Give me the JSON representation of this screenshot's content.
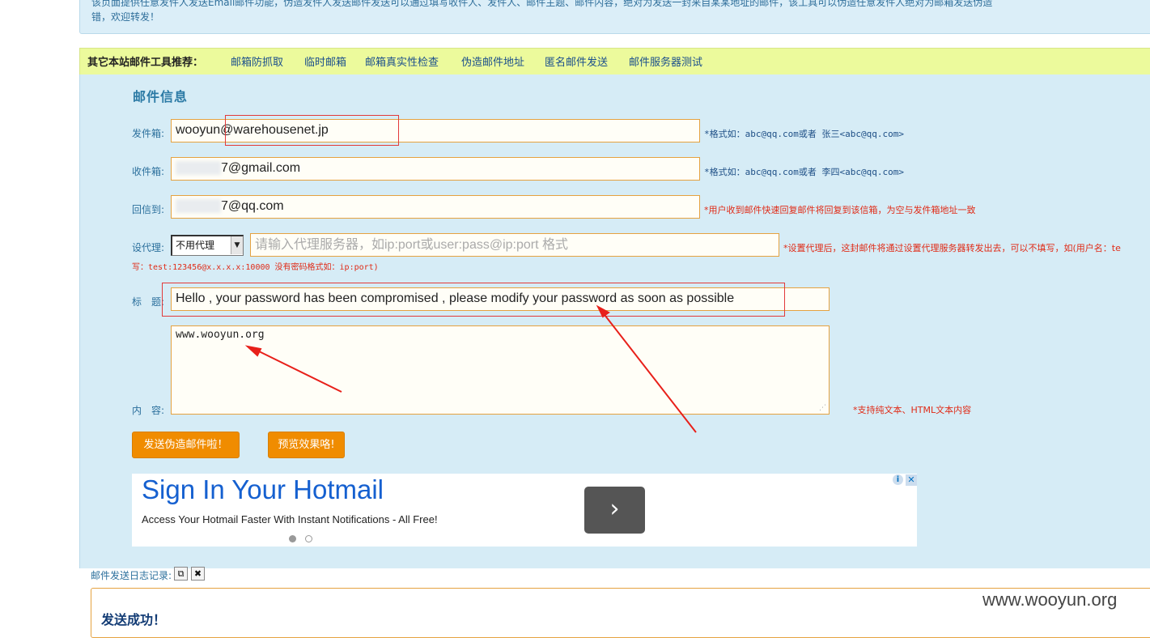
{
  "notice": {
    "line1": "该页面提供任意发件人发送Email邮件功能，伪造发件人发送邮件发送可以通过填写收件人、发件人、邮件主题、邮件内容，绝对为发送一封来自某某地址的邮件，该工具可以伪造任意发件人绝对为邮箱发送伪造",
    "line2": "错，欢迎转发！"
  },
  "tools": {
    "title": "其它本站邮件工具推荐：",
    "links": [
      "邮箱防抓取",
      "临时邮箱",
      "邮箱真实性检查",
      "伪造邮件地址",
      "匿名邮件发送",
      "邮件服务器测试"
    ]
  },
  "form": {
    "section_title": "邮件信息",
    "sender": {
      "label": "发件箱:",
      "value": "wooyun@warehousenet.jp",
      "hint": "*格式如：abc@qq.com或者 张三<abc@qq.com>"
    },
    "recipient": {
      "label": "收件箱:",
      "value_hidden": "xxxxxxx",
      "value_visible": "7@gmail.com",
      "hint": "*格式如：abc@qq.com或者 李四<abc@qq.com>"
    },
    "reply_to": {
      "label": "回信到:",
      "value_hidden": "xxxxxxx",
      "value_visible": "7@qq.com",
      "hint": "*用户收到邮件快速回复邮件将回复到该信箱，为空与发件箱地址一致"
    },
    "proxy": {
      "label": "设代理:",
      "selected": "不用代理",
      "placeholder": "请输入代理服务器，如ip:port或user:pass@ip:port 格式",
      "hint_line1": "*设置代理后，这封邮件将通过设置代理服务器转发出去，可以不填写，如(用户名：te",
      "hint_line2": "写：test:123456@x.x.x.x:10000 没有密码格式如：ip:port)"
    },
    "subject": {
      "label": "标　题:",
      "value": "Hello , your password has been compromised , please modify your password as soon as possible"
    },
    "content": {
      "label": "内　容:",
      "value": "www.wooyun.org",
      "hint": "*支持纯文本、HTML文本内容"
    },
    "send_button": "发送伪造邮件啦！",
    "preview_button": "预览效果咯!"
  },
  "ad": {
    "title": "Sign In Your Hotmail",
    "description": "Access Your Hotmail Faster With Instant Notifications - All Free!",
    "next_symbol": "›",
    "info_symbol": "i",
    "close_symbol": "✕"
  },
  "log": {
    "label": "邮件发送日志记录:",
    "copy_symbol": "⧉",
    "clear_symbol": "✖",
    "result": "发送成功！"
  },
  "watermark": "www.wooyun.org",
  "colors": {
    "panel_bg": "#d6ecf6",
    "tools_bg": "#ecfa9c",
    "button_orange": "#f08c00",
    "annotation_red": "#e23a3a"
  }
}
